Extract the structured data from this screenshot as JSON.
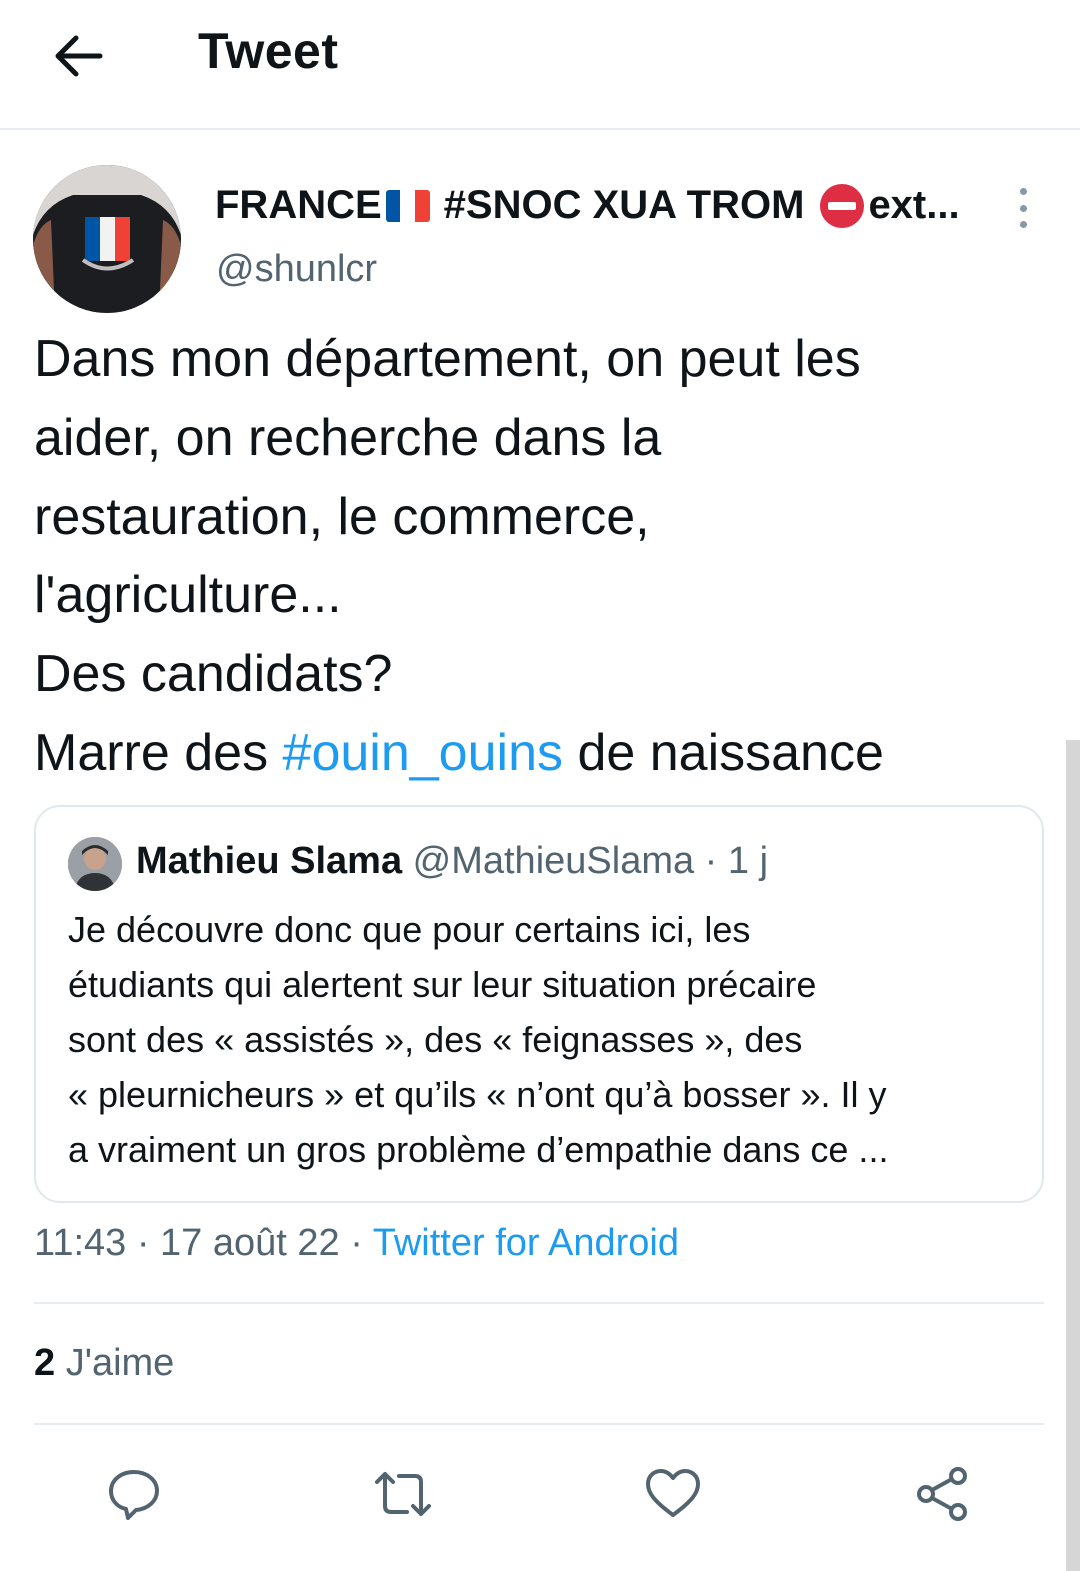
{
  "header": {
    "title": "Tweet",
    "back_icon": "arrow-left-icon"
  },
  "author": {
    "name_prefix": "FRANCE",
    "name_middle": "#SNOC XUA TROM",
    "name_suffix": "ext...",
    "handle": "@shunlcr",
    "flag_colors": [
      "#0055a4",
      "#ffffff",
      "#ef4135"
    ],
    "no_entry_color": "#dd2e44"
  },
  "tweet": {
    "line1": "Dans mon département, on peut les",
    "line2": "aider, on recherche dans la",
    "line3": "restauration, le commerce,",
    "line4": "l'agriculture...",
    "line5": "Des candidats?",
    "line6_before": "Marre des ",
    "line6_hashtag": "#ouin_ouins",
    "line6_after": " de naissance"
  },
  "quote": {
    "name": "Mathieu Slama",
    "meta": " @MathieuSlama · 1 j",
    "line1": "Je découvre donc que pour certains ici, les",
    "line2": "étudiants qui alertent sur leur situation précaire",
    "line3": "sont des « assistés », des « feignasses », des",
    "line4": "« pleurnicheurs » et qu’ils « n’ont qu’à bosser ». Il y",
    "line5": "a vraiment un gros problème d’empathie dans ce ..."
  },
  "meta": {
    "time_date": "11:43 · 17 août 22 · ",
    "source": "Twitter for Android"
  },
  "stats": {
    "likes_count": "2",
    "likes_label": " J'aime"
  },
  "actions": {
    "reply_icon": "reply-icon",
    "retweet_icon": "retweet-icon",
    "like_icon": "heart-icon",
    "share_icon": "share-icon"
  },
  "colors": {
    "accent": "#1d9bf0",
    "secondary_text": "#536471",
    "icon_gray": "#536471",
    "border": "#e6ecf0"
  }
}
